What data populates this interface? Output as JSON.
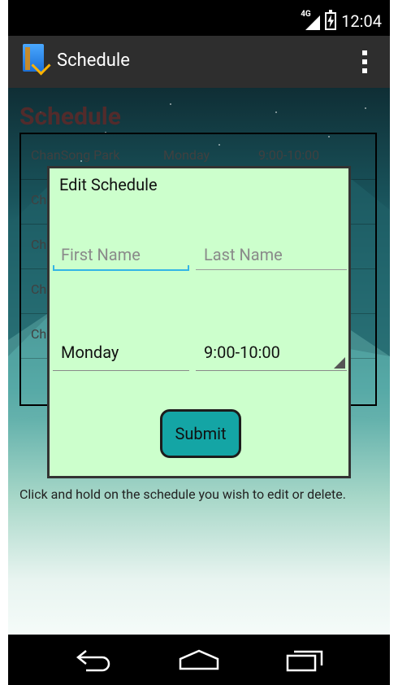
{
  "status_bar": {
    "network": "4G",
    "time": "12:04"
  },
  "action_bar": {
    "title": "Schedule"
  },
  "background": {
    "title": "Schedule",
    "rows": [
      {
        "name": "ChanSong Park",
        "day": "Monday",
        "time": "9:00-10:00"
      },
      {
        "name": "Ch",
        "day": "",
        "time": ""
      },
      {
        "name": "Ch",
        "day": "",
        "time": ""
      },
      {
        "name": "Ch",
        "day": "",
        "time": ""
      },
      {
        "name": "Ch",
        "day": "",
        "time": ""
      }
    ],
    "hint": "Click and hold on the schedule you wish to edit or delete."
  },
  "dialog": {
    "title": "Edit Schedule",
    "first_name_placeholder": "First Name",
    "last_name_placeholder": "Last Name",
    "day_value": "Monday",
    "time_value": "9:00-10:00",
    "submit_label": "Submit"
  },
  "icons": {
    "app": "app-book-icon",
    "overflow": "overflow-menu-icon",
    "back": "back-icon",
    "home": "home-icon",
    "recent": "recent-apps-icon"
  },
  "colors": {
    "dialog_bg": "#ccffcc",
    "submit_bg": "#14a5a5",
    "focus_underline": "#33b5e5",
    "action_bar": "#2e2e2e"
  }
}
